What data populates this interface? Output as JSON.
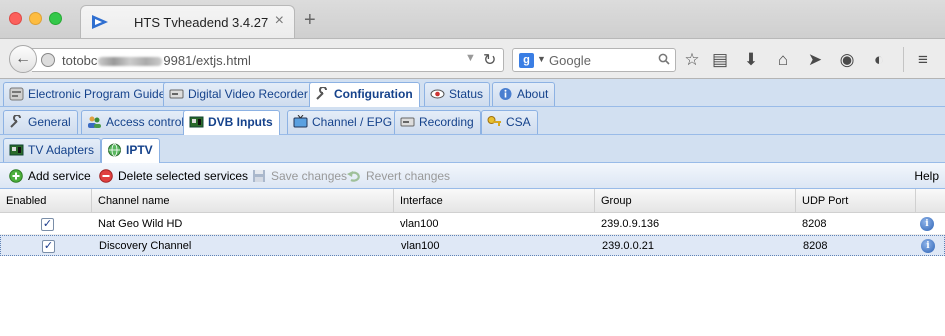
{
  "browser": {
    "tab_title": "HTS Tvheadend 3.4.27",
    "tab_close": "×",
    "new_tab": "+",
    "url_prefix": "totobc",
    "url_suffix": "9981/extjs.html",
    "search_placeholder": "Google",
    "search_engine_letter": "g"
  },
  "main_tabs": [
    {
      "label": "Electronic Program Guide",
      "icon": "epg-icon"
    },
    {
      "label": "Digital Video Recorder",
      "icon": "dvr-icon"
    },
    {
      "label": "Configuration",
      "icon": "wrench-icon",
      "active": true
    },
    {
      "label": "Status",
      "icon": "eye-icon"
    },
    {
      "label": "About",
      "icon": "info-icon"
    }
  ],
  "config_tabs": [
    {
      "label": "General",
      "icon": "wrench-icon"
    },
    {
      "label": "Access control",
      "icon": "users-icon"
    },
    {
      "label": "DVB Inputs",
      "icon": "card-icon",
      "active": true
    },
    {
      "label": "Channel / EPG",
      "icon": "tv-icon"
    },
    {
      "label": "Recording",
      "icon": "dvr-icon"
    },
    {
      "label": "CSA",
      "icon": "key-icon"
    }
  ],
  "dvb_tabs": [
    {
      "label": "TV Adapters",
      "icon": "card-icon"
    },
    {
      "label": "IPTV",
      "icon": "globe-icon",
      "active": true
    }
  ],
  "toolbar": {
    "add_service": "Add service",
    "delete_selected": "Delete selected services",
    "save_changes": "Save changes",
    "revert_changes": "Revert changes",
    "help": "Help"
  },
  "grid": {
    "columns": [
      "Enabled",
      "Channel name",
      "Interface",
      "Group",
      "UDP Port"
    ],
    "rows": [
      {
        "enabled": "✓",
        "channel": "Nat Geo Wild HD",
        "interface": "vlan100",
        "group": "239.0.9.136",
        "port": "8208",
        "info": "i"
      },
      {
        "enabled": "✓",
        "channel": "Discovery Channel",
        "interface": "vlan100",
        "group": "239.0.0.21",
        "port": "8208",
        "info": "i"
      }
    ]
  },
  "colors": {
    "accent": "#15428b",
    "tab_strip": "#d2e0f1",
    "selected_row": "#dfe8f6"
  }
}
